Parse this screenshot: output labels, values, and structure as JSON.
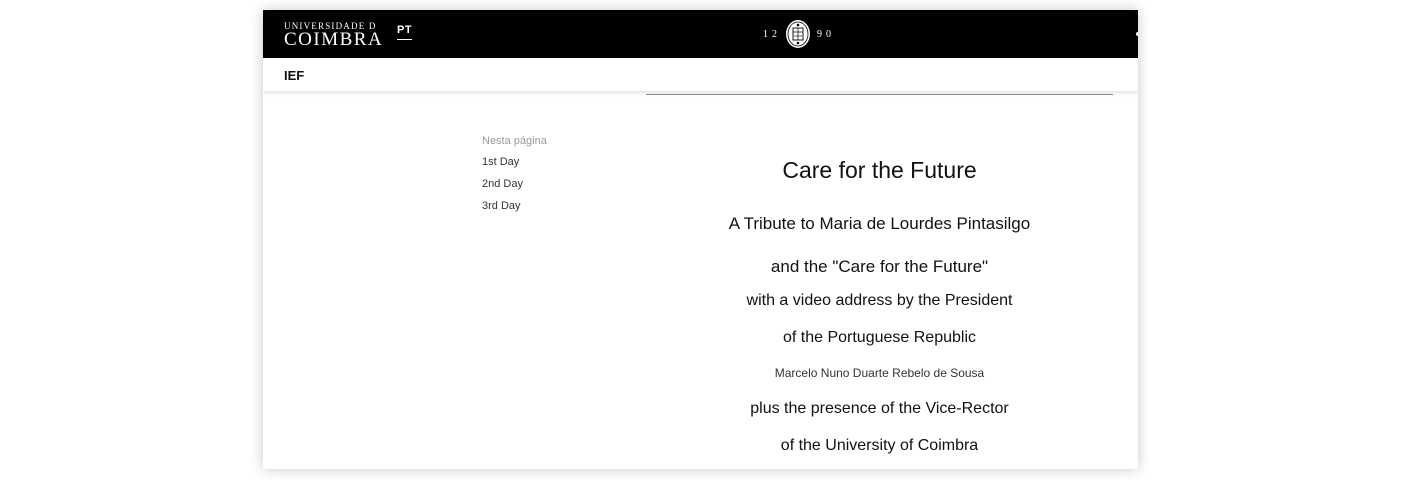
{
  "header": {
    "logo_line1": "UNIVERSIDADE D",
    "logo_line2": "COIMBRA",
    "language": "PT",
    "year_left": "12",
    "year_right": "90",
    "seal_icon": "university-seal-icon"
  },
  "subheader": {
    "section": "IEF"
  },
  "toc": {
    "title": "Nesta página",
    "items": [
      "1st Day",
      "2nd Day",
      "3rd Day"
    ]
  },
  "content": {
    "title": "Care for the Future",
    "line1": "A Tribute to Maria de Lourdes Pintasilgo",
    "line2": "and the \"Care for the Future\"",
    "line3": "with a video address by the President",
    "line4": "of the Portuguese Republic",
    "line5": "Marcelo Nuno Duarte Rebelo de Sousa",
    "line6": "plus the presence of the Vice-Rector",
    "line7": "of the University of Coimbra"
  },
  "colors": {
    "topbar": "#000000",
    "text": "#111111",
    "muted": "#9a9a9a"
  }
}
